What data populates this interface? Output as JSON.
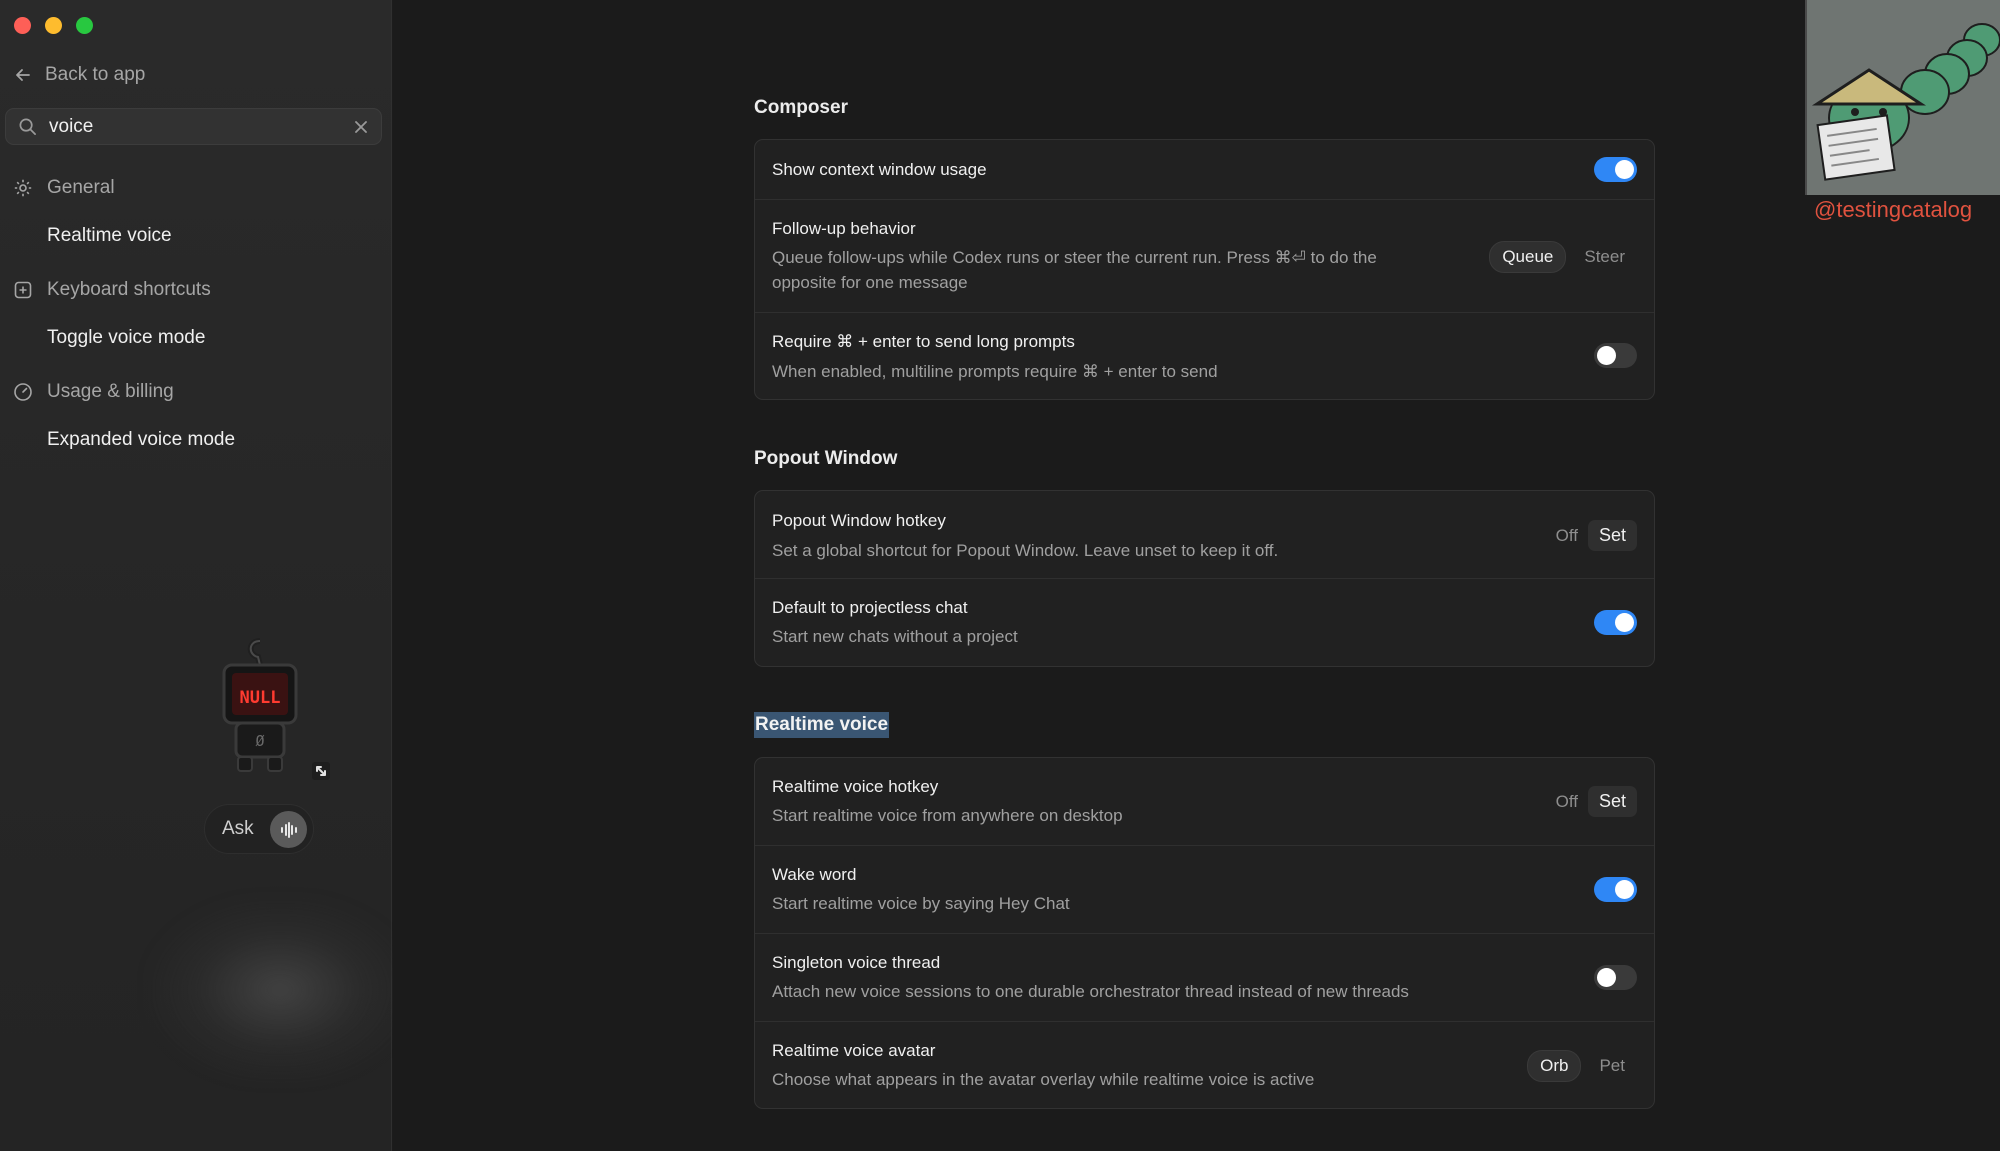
{
  "window": {
    "traffic_lights": [
      "close",
      "minimize",
      "zoom"
    ]
  },
  "sidebar": {
    "back_label": "Back to app",
    "search": {
      "value": "voice",
      "placeholder": ""
    },
    "sections": [
      {
        "label": "General",
        "icon": "gear-icon",
        "results": [
          "Realtime voice"
        ]
      },
      {
        "label": "Keyboard shortcuts",
        "icon": "keyboard-icon",
        "results": [
          "Toggle voice mode"
        ]
      },
      {
        "label": "Usage & billing",
        "icon": "gauge-icon",
        "results": [
          "Expanded voice mode"
        ]
      }
    ],
    "pet": {
      "screen_text": "NULL",
      "chest_text": "Ø"
    },
    "ask_label": "Ask"
  },
  "composer": {
    "title": "Composer",
    "show_context": {
      "title": "Show context window usage",
      "enabled": true
    },
    "followup": {
      "title": "Follow-up behavior",
      "desc_line1": "Queue follow-ups while Codex runs or steer the current run. Press ⌘⏎ to do the",
      "desc_line2": "opposite for one message",
      "options": [
        "Queue",
        "Steer"
      ],
      "selected": "Queue"
    },
    "require_cmd": {
      "title": "Require ⌘ + enter to send long prompts",
      "desc": "When enabled, multiline prompts require ⌘ + enter to send",
      "enabled": false
    }
  },
  "popout": {
    "title": "Popout Window",
    "hotkey": {
      "title": "Popout Window hotkey",
      "desc": "Set a global shortcut for Popout Window. Leave unset to keep it off.",
      "value": "Off",
      "set_label": "Set"
    },
    "projectless": {
      "title": "Default to projectless chat",
      "desc": "Start new chats without a project",
      "enabled": true
    }
  },
  "realtime": {
    "title": "Realtime voice",
    "hotkey": {
      "title": "Realtime voice hotkey",
      "desc": "Start realtime voice from anywhere on desktop",
      "value": "Off",
      "set_label": "Set"
    },
    "wake": {
      "title": "Wake word",
      "desc": "Start realtime voice by saying Hey Chat",
      "enabled": true
    },
    "singleton": {
      "title": "Singleton voice thread",
      "desc": "Attach new voice sessions to one durable orchestrator thread instead of new threads",
      "enabled": false
    },
    "avatar": {
      "title": "Realtime voice avatar",
      "desc": "Choose what appears in the avatar overlay while realtime voice is active",
      "options": [
        "Orb",
        "Pet"
      ],
      "selected": "Orb"
    }
  },
  "watermark": "@testingcatalog",
  "colors": {
    "accent": "#2f87f5",
    "highlight": "#3a5673",
    "watermark": "#e0523f"
  }
}
